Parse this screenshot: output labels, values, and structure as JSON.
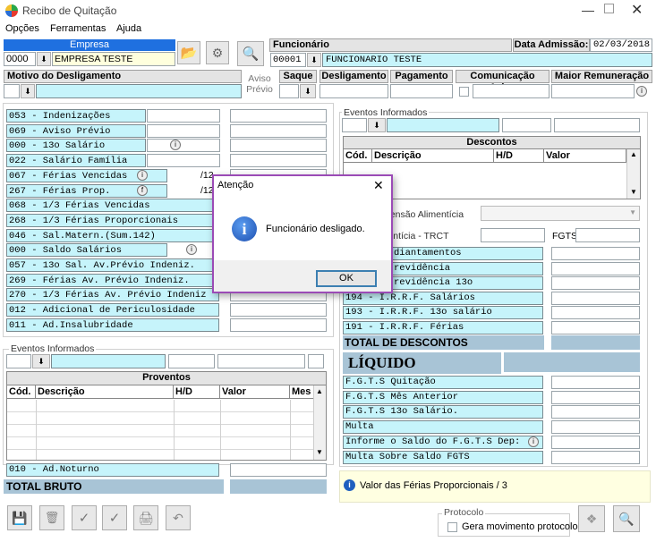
{
  "window": {
    "title": "Recibo de Quitação"
  },
  "menu": [
    "Opções",
    "Ferramentas",
    "Ajuda"
  ],
  "empresa": {
    "header": "Empresa",
    "code": "0000",
    "name": "EMPRESA TESTE"
  },
  "funcionario": {
    "header": "Funcionário",
    "code": "00001",
    "name": "FUNCIONARIO TESTE",
    "data_admissao_label": "Data Admissão:",
    "data_admissao": "02/03/2018"
  },
  "headers": {
    "motivo": "Motivo do Desligamento",
    "aviso": "Aviso Prévio",
    "saque": "Saque",
    "desligamento": "Desligamento",
    "pagamento": "Pagamento",
    "comunicacao": "Comunicação Aviso",
    "maior_rem": "Maior Remuneração"
  },
  "proventos_list": [
    "053 - Indenizações",
    "069 - Aviso Prévio",
    "000 - 13o Salário",
    "022 - Salário Família",
    "067 - Férias Vencidas",
    "267 - Férias Prop.",
    "068 - 1/3 Férias Vencidas",
    "268 - 1/3 Férias Proporcionais",
    "046 - Sal.Matern.(Sum.142)",
    "000 - Saldo Salários",
    "057 - 13o Sal. Av.Prévio Indeniz.",
    "269 -  Férias  Av. Prévio Indeniz.",
    "270 - 1/3 Férias Av. Prévio Indeniz",
    "012 - Adicional de Periculosidade",
    "011 - Ad.Insalubridade"
  ],
  "fraction_suffix": "/12",
  "eventos_label": "Eventos Informados",
  "proventos": {
    "title": "Proventos",
    "cols": [
      "Cód.",
      "Descrição",
      "H/D",
      "Valor",
      "Mes"
    ]
  },
  "adnoturno": "010 - Ad.Noturno",
  "total_bruto": "TOTAL BRUTO",
  "descontos": {
    "title": "Descontos",
    "cols": [
      "Cód.",
      "Descrição",
      "H/D",
      "Valor"
    ]
  },
  "pensao_label": "e Pensão Alimentícia",
  "alimenticia_label": "limentícia - TRCT",
  "fgts_label": "FGTS",
  "descontos_list": [
    "diantamentos",
    "revidência",
    "revidência 13o",
    "194 - I.R.R.F. Salários",
    "193 - I.R.R.F. 13o salário",
    "191 - I.R.R.F. Férias"
  ],
  "total_descontos": "TOTAL DE DESCONTOS",
  "liquido": "LÍQUIDO",
  "fgts_list": [
    "F.G.T.S  Quitação",
    "F.G.T.S  Mês Anterior",
    "F.G.T.S  13o Salário.",
    "Multa",
    "Informe o Saldo do F.G.T.S Dep:",
    "Multa Sobre Saldo FGTS"
  ],
  "status_msg": "Valor das Férias Proporcionais / 3",
  "protocolo": {
    "label": "Protocolo",
    "check_label": "Gera movimento protocolo"
  },
  "dialog": {
    "title": "Atenção",
    "message": "Funcionário desligado.",
    "ok": "OK"
  }
}
